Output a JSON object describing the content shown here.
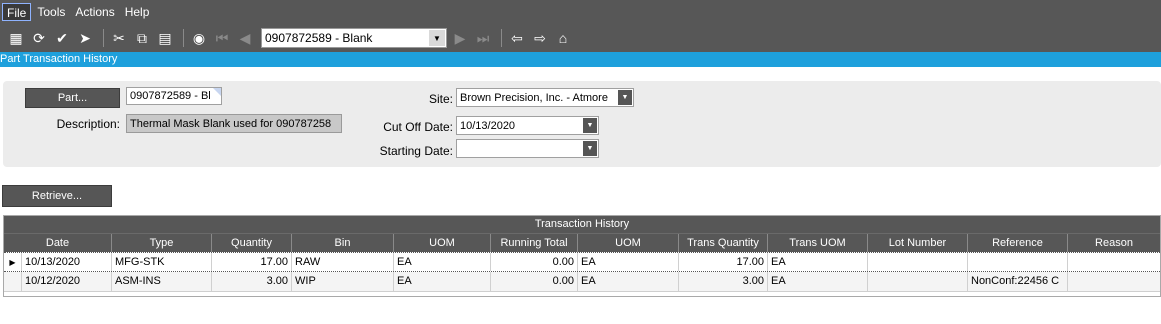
{
  "menu": [
    "File",
    "Tools",
    "Actions",
    "Help"
  ],
  "toolbar": {
    "icons_left": [
      "clipboard-icon",
      "refresh-icon",
      "clear-icon",
      "next-arrow-icon"
    ],
    "icons_edit": [
      "cut-icon",
      "copy-icon",
      "paste-icon"
    ],
    "record_combo_value": "0907872589 - Blank",
    "icons_nav_right": [
      "back-icon",
      "forward-icon",
      "home-icon"
    ]
  },
  "title": "Part Transaction History",
  "form": {
    "part_button": "Part...",
    "part_value": "0907872589 - Bl",
    "description_label": "Description:",
    "description_value": "Thermal Mask Blank used for 090787258",
    "site_label": "Site:",
    "site_value": "Brown Precision, Inc. - Atmore",
    "cutoff_label": "Cut Off Date:",
    "cutoff_value": "10/13/2020",
    "starting_label": "Starting Date:",
    "starting_value": "",
    "retrieve_button": "Retrieve..."
  },
  "grid": {
    "caption": "Transaction History",
    "columns": [
      "Date",
      "Type",
      "Quantity",
      "Bin",
      "UOM",
      "Running Total",
      "UOM",
      "Trans Quantity",
      "Trans UOM",
      "Lot Number",
      "Reference",
      "Reason"
    ],
    "rows": [
      [
        "10/13/2020",
        "MFG-STK",
        "17.00",
        "RAW",
        "EA",
        "0.00",
        "EA",
        "17.00",
        "EA",
        "",
        "",
        ""
      ],
      [
        "10/12/2020",
        "ASM-INS",
        "3.00",
        "WIP",
        "EA",
        "0.00",
        "EA",
        "3.00",
        "EA",
        "",
        "NonConf:22456 C",
        ""
      ]
    ]
  }
}
